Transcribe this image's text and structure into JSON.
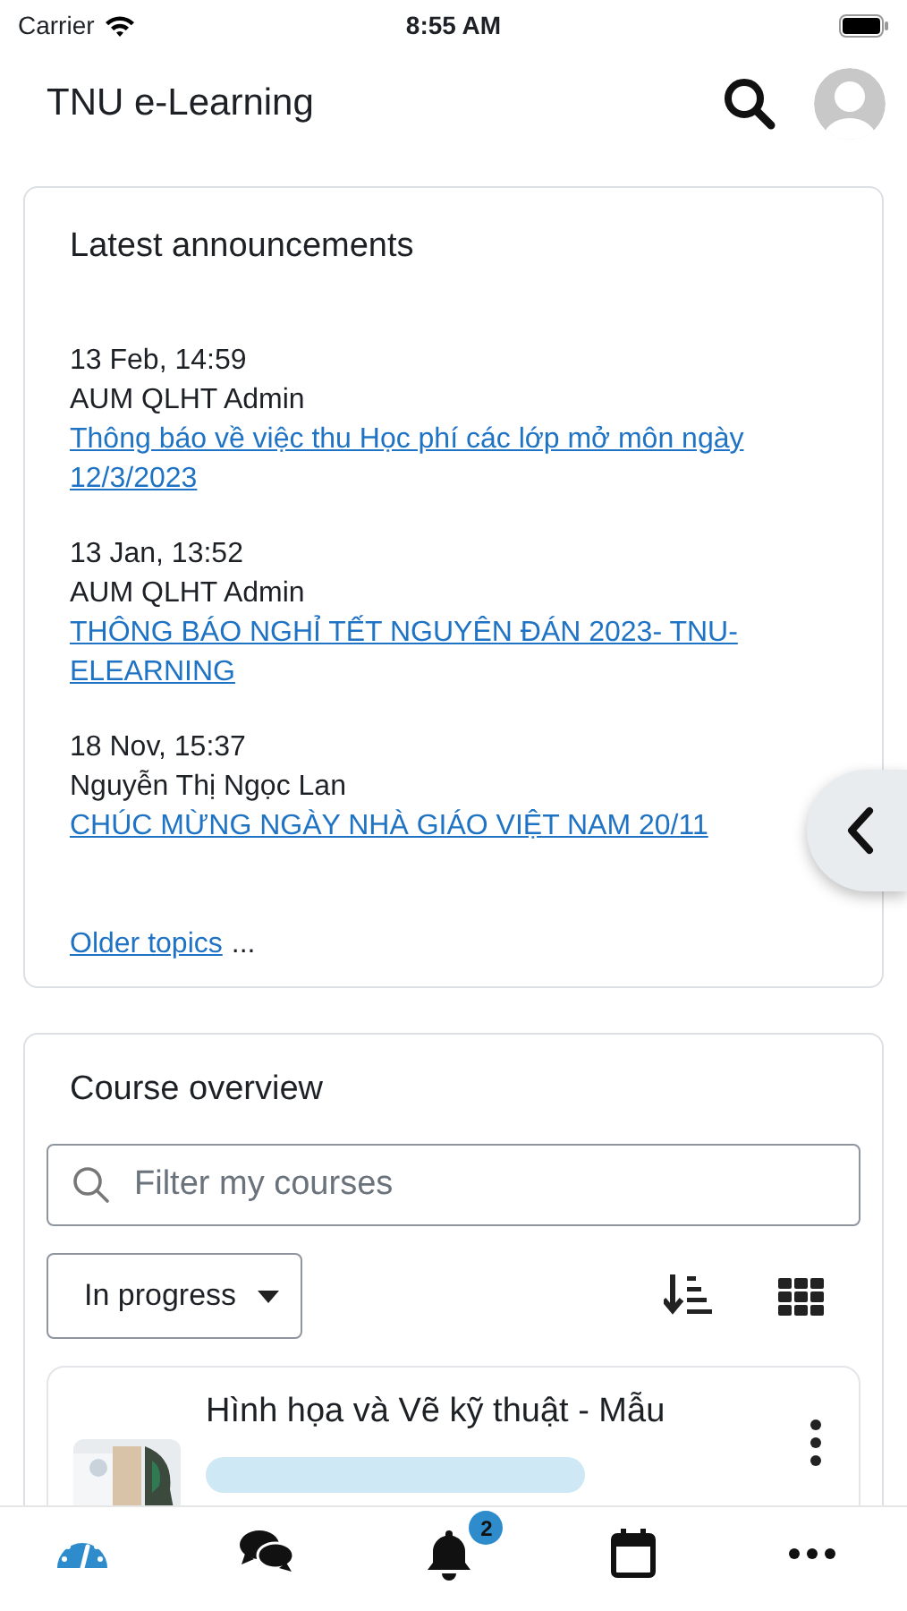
{
  "status_bar": {
    "carrier": "Carrier",
    "time": "8:55 AM"
  },
  "header": {
    "title": "TNU e-Learning"
  },
  "announcements": {
    "title": "Latest announcements",
    "items": [
      {
        "date": "13 Feb, 14:59",
        "author": "AUM QLHT Admin",
        "link": "Thông báo về việc thu Học phí các lớp mở môn ngày 12/3/2023"
      },
      {
        "date": "13 Jan, 13:52",
        "author": "AUM QLHT Admin",
        "link": "THÔNG BÁO NGHỈ TẾT NGUYÊN ĐÁN 2023- TNU-ELEARNING"
      },
      {
        "date": "18 Nov, 15:37",
        "author": "Nguyễn Thị Ngọc Lan",
        "link": "CHÚC MỪNG NGÀY NHÀ GIÁO VIỆT NAM 20/11"
      }
    ],
    "older_link": "Older topics",
    "older_suffix": "..."
  },
  "course_overview": {
    "title": "Course overview",
    "filter": {
      "placeholder": "Filter my courses"
    },
    "status_dropdown": "In progress",
    "courses": [
      {
        "name": "Hình họa và Vẽ kỹ thuật - Mẫu"
      }
    ]
  },
  "tab_bar": [
    {
      "kind": "dashboard",
      "selected": true
    },
    {
      "kind": "messages",
      "selected": false
    },
    {
      "kind": "notifications",
      "selected": false,
      "badge": "2"
    },
    {
      "kind": "calendar",
      "selected": false
    },
    {
      "kind": "more",
      "selected": false
    }
  ]
}
